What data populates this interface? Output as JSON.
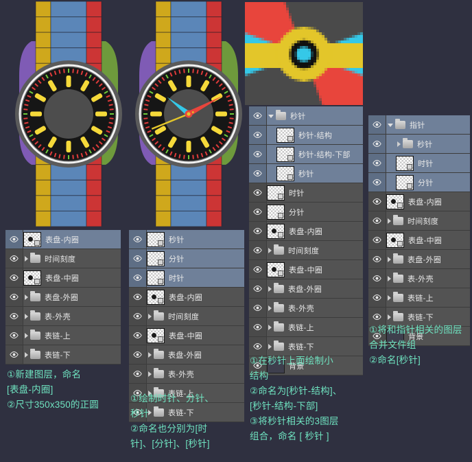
{
  "meta": {
    "bg_color": "#2f3040",
    "accent_caption_color": "#6fe3c0",
    "panel_bg": "#535353",
    "panel_selected": "#6f8099"
  },
  "illustration": {
    "watch_left_name": "watch-preview-no-hands",
    "watch_right_name": "watch-preview-with-hands",
    "pixel_preview_name": "zoomed-hands-center-preview",
    "colors": {
      "band_blue": "#5b86b8",
      "band_yellow": "#cfa81c",
      "band_red": "#cc3535",
      "band_green": "#6e9a3c",
      "band_purple": "#7f5bb5",
      "case": "#5b5b5b",
      "case_highlight": "#f2f2f2",
      "dial_outer": "#161616",
      "dial_inner": "#4d4d4d",
      "tick": "#f5d93a",
      "tick_red": "#e03b3b",
      "tick_green": "#6ecb3a",
      "hour_hand": "#35c8e8",
      "minute_hand": "#e8453c",
      "second_hand": "#e3c62a"
    }
  },
  "panels": [
    {
      "id": "panel-1",
      "name": "layers-panel-step-1",
      "rows": [
        {
          "label": "表盘-内圈",
          "type": "layer",
          "indent": 0,
          "selected": true,
          "thumb": "shape"
        },
        {
          "label": "时间刻度",
          "type": "group",
          "indent": 0,
          "selected": false,
          "expanded": false
        },
        {
          "label": "表盘-中圈",
          "type": "layer",
          "indent": 0,
          "selected": false,
          "thumb": "shape"
        },
        {
          "label": "表盘-外圈",
          "type": "group",
          "indent": 0,
          "selected": false,
          "expanded": false
        },
        {
          "label": "表-外壳",
          "type": "group",
          "indent": 0,
          "selected": false,
          "expanded": false
        },
        {
          "label": "表链-上",
          "type": "group",
          "indent": 0,
          "selected": false,
          "expanded": false
        },
        {
          "label": "表链-下",
          "type": "group",
          "indent": 0,
          "selected": false,
          "expanded": false
        }
      ]
    },
    {
      "id": "panel-2",
      "name": "layers-panel-step-2",
      "rows": [
        {
          "label": "秒针",
          "type": "layer",
          "indent": 0,
          "selected": true,
          "thumb": "hand"
        },
        {
          "label": "分针",
          "type": "layer",
          "indent": 0,
          "selected": true,
          "thumb": "hand"
        },
        {
          "label": "时针",
          "type": "layer",
          "indent": 0,
          "selected": true,
          "thumb": "hand"
        },
        {
          "label": "表盘-内圈",
          "type": "layer",
          "indent": 0,
          "selected": false,
          "thumb": "shape"
        },
        {
          "label": "时间刻度",
          "type": "group",
          "indent": 0,
          "selected": false,
          "expanded": false
        },
        {
          "label": "表盘-中圈",
          "type": "layer",
          "indent": 0,
          "selected": false,
          "thumb": "shape"
        },
        {
          "label": "表盘-外圈",
          "type": "group",
          "indent": 0,
          "selected": false,
          "expanded": false
        },
        {
          "label": "表-外壳",
          "type": "group",
          "indent": 0,
          "selected": false,
          "expanded": false
        },
        {
          "label": "表链-上",
          "type": "group",
          "indent": 0,
          "selected": false,
          "expanded": false
        },
        {
          "label": "表链-下",
          "type": "group",
          "indent": 0,
          "selected": false,
          "expanded": false
        }
      ]
    },
    {
      "id": "panel-3",
      "name": "layers-panel-step-3",
      "rows": [
        {
          "label": "秒针",
          "type": "group",
          "indent": 0,
          "selected": true,
          "expanded": true
        },
        {
          "label": "秒针-结构",
          "type": "layer",
          "indent": 1,
          "selected": true,
          "thumb": "hand"
        },
        {
          "label": "秒针-结构-下部",
          "type": "layer",
          "indent": 1,
          "selected": true,
          "thumb": "hand"
        },
        {
          "label": "秒针",
          "type": "layer",
          "indent": 1,
          "selected": true,
          "thumb": "hand"
        },
        {
          "label": "时针",
          "type": "layer",
          "indent": 0,
          "selected": false,
          "thumb": "hand"
        },
        {
          "label": "分针",
          "type": "layer",
          "indent": 0,
          "selected": false,
          "thumb": "hand"
        },
        {
          "label": "表盘-内圈",
          "type": "layer",
          "indent": 0,
          "selected": false,
          "thumb": "shape"
        },
        {
          "label": "时间刻度",
          "type": "group",
          "indent": 0,
          "selected": false,
          "expanded": false
        },
        {
          "label": "表盘-中圈",
          "type": "layer",
          "indent": 0,
          "selected": false,
          "thumb": "shape"
        },
        {
          "label": "表盘-外圈",
          "type": "group",
          "indent": 0,
          "selected": false,
          "expanded": false
        },
        {
          "label": "表-外壳",
          "type": "group",
          "indent": 0,
          "selected": false,
          "expanded": false
        },
        {
          "label": "表链-上",
          "type": "group",
          "indent": 0,
          "selected": false,
          "expanded": false
        },
        {
          "label": "表链-下",
          "type": "group",
          "indent": 0,
          "selected": false,
          "expanded": false
        },
        {
          "label": "背景",
          "type": "layer",
          "indent": 0,
          "selected": false,
          "thumb": "solid"
        }
      ]
    },
    {
      "id": "panel-4",
      "name": "layers-panel-step-4",
      "rows": [
        {
          "label": "指针",
          "type": "group",
          "indent": 0,
          "selected": true,
          "expanded": true
        },
        {
          "label": "秒针",
          "type": "group",
          "indent": 1,
          "selected": true,
          "expanded": false
        },
        {
          "label": "时针",
          "type": "layer",
          "indent": 1,
          "selected": true,
          "thumb": "hand"
        },
        {
          "label": "分针",
          "type": "layer",
          "indent": 1,
          "selected": true,
          "thumb": "hand"
        },
        {
          "label": "表盘-内圈",
          "type": "layer",
          "indent": 0,
          "selected": false,
          "thumb": "shape"
        },
        {
          "label": "时间刻度",
          "type": "group",
          "indent": 0,
          "selected": false,
          "expanded": false
        },
        {
          "label": "表盘-中圈",
          "type": "layer",
          "indent": 0,
          "selected": false,
          "thumb": "shape"
        },
        {
          "label": "表盘-外圈",
          "type": "group",
          "indent": 0,
          "selected": false,
          "expanded": false
        },
        {
          "label": "表-外壳",
          "type": "group",
          "indent": 0,
          "selected": false,
          "expanded": false
        },
        {
          "label": "表链-上",
          "type": "group",
          "indent": 0,
          "selected": false,
          "expanded": false
        },
        {
          "label": "表链-下",
          "type": "group",
          "indent": 0,
          "selected": false,
          "expanded": false
        },
        {
          "label": "背景",
          "type": "layer",
          "indent": 0,
          "selected": false,
          "thumb": "solid"
        }
      ]
    }
  ],
  "captions": [
    {
      "id": "caption-1",
      "name": "caption-step-1",
      "text": "①新建图层，命名\n  [表盘-内圈]\n②尺寸350x350的正圆"
    },
    {
      "id": "caption-2",
      "name": "caption-step-2",
      "text": "①绘制时针、分针、\n  秒针\n②命名也分别为[时\n针]、[分针]、[秒针]"
    },
    {
      "id": "caption-3",
      "name": "caption-step-3",
      "text": "①在秒针上面绘制小\n  结构\n②命名为[秒针-结构]、\n  [秒针-结构-下部]\n③将秒针相关的3图层\n  组合，命名 [ 秒针 ]"
    },
    {
      "id": "caption-4",
      "name": "caption-step-4",
      "text": "①将和指针相关的图层\n合并文件组\n②命名[秒针]"
    }
  ]
}
